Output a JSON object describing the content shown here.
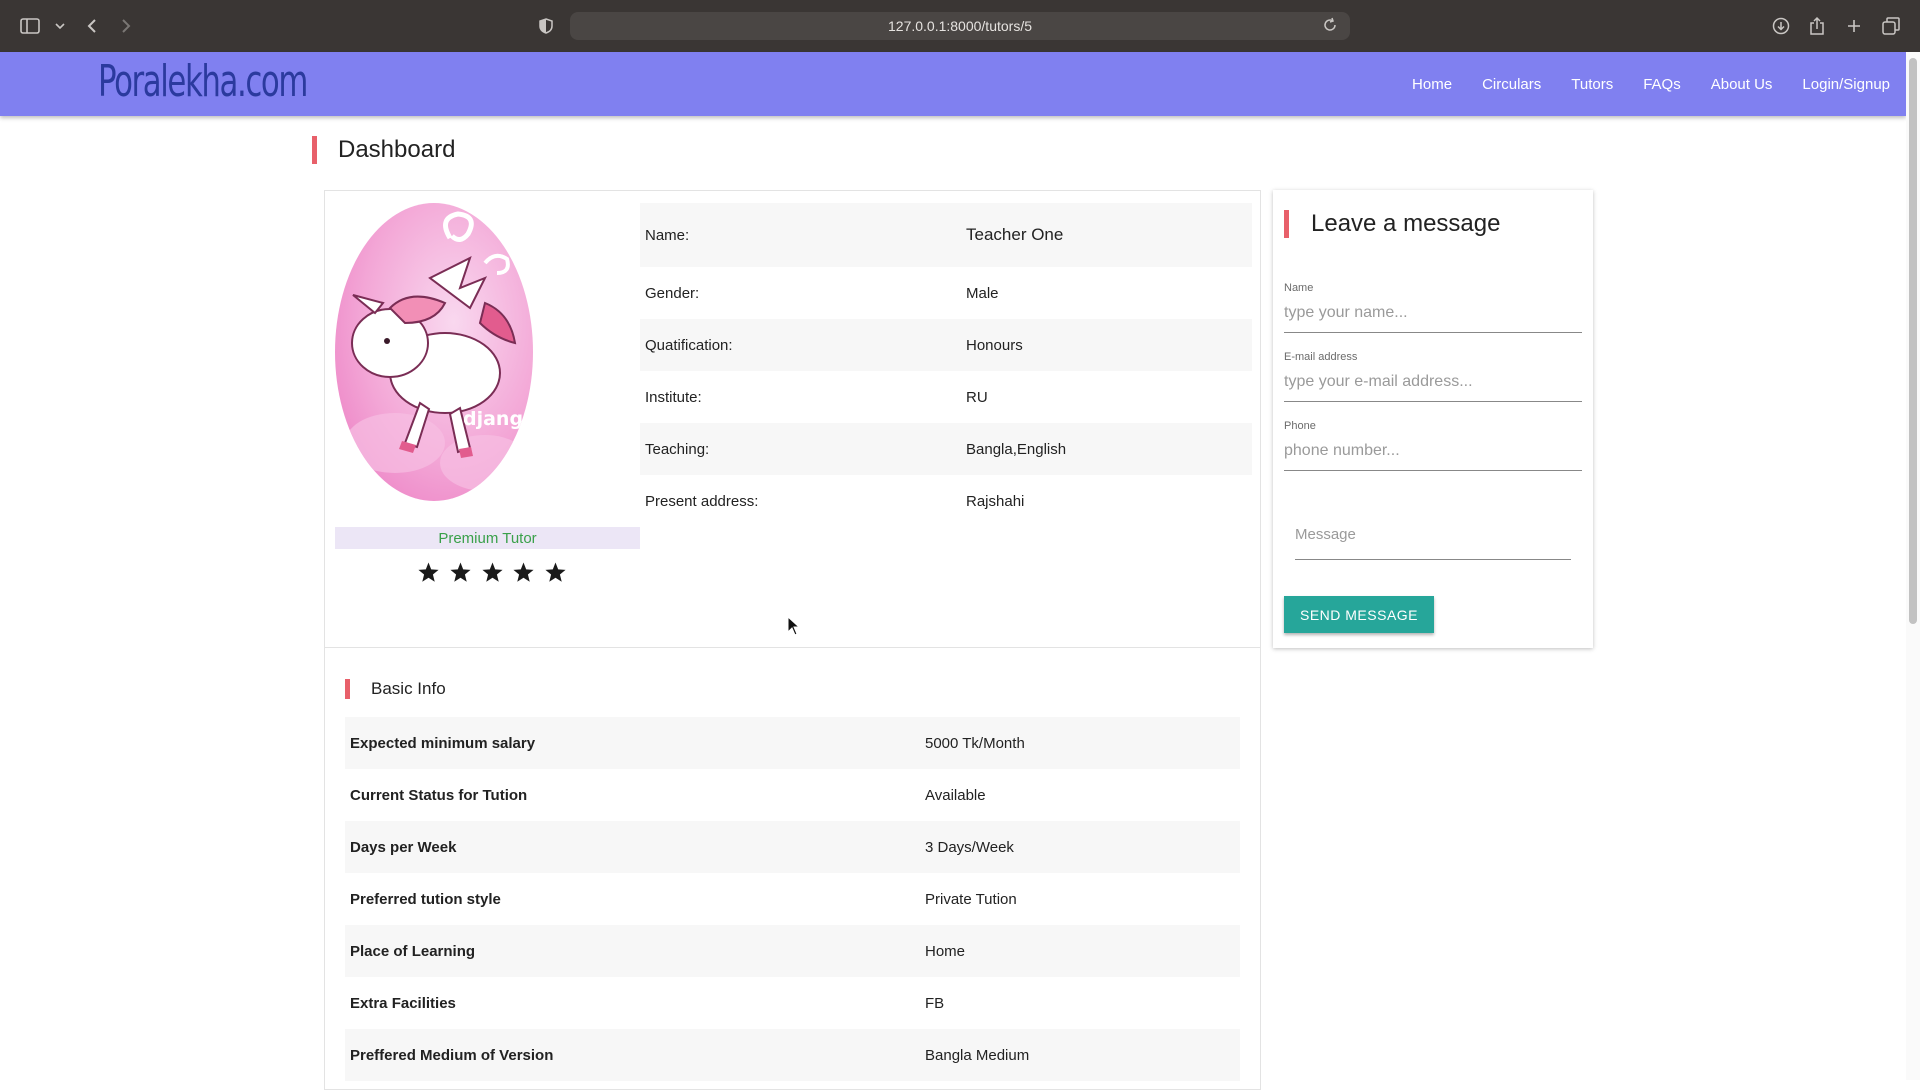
{
  "browser": {
    "url": "127.0.0.1:8000/tutors/5"
  },
  "navbar": {
    "logo": "Poralekha.com",
    "links": [
      "Home",
      "Circulars",
      "Tutors",
      "FAQs",
      "About Us",
      "Login/Signup"
    ]
  },
  "page": {
    "title": "Dashboard"
  },
  "profile": {
    "avatar_text": "django",
    "badge": "Premium Tutor",
    "rating_stars": 5,
    "details": [
      {
        "label": "Name:",
        "value": "Teacher One"
      },
      {
        "label": "Gender:",
        "value": "Male"
      },
      {
        "label": "Quatification:",
        "value": "Honours"
      },
      {
        "label": "Institute:",
        "value": "RU"
      },
      {
        "label": "Teaching:",
        "value": "Bangla,English"
      },
      {
        "label": "Present address:",
        "value": "Rajshahi"
      }
    ]
  },
  "basic_info": {
    "title": "Basic Info",
    "rows": [
      {
        "label": "Expected minimum salary",
        "value": "5000 Tk/Month"
      },
      {
        "label": "Current Status for Tution",
        "value": "Available"
      },
      {
        "label": "Days per Week",
        "value": "3 Days/Week"
      },
      {
        "label": "Preferred tution style",
        "value": "Private Tution"
      },
      {
        "label": "Place of Learning",
        "value": "Home"
      },
      {
        "label": "Extra Facilities",
        "value": "FB"
      },
      {
        "label": "Preffered Medium of Version",
        "value": "Bangla Medium"
      }
    ]
  },
  "message_form": {
    "title": "Leave a message",
    "name_label": "Name",
    "name_placeholder": "type your name...",
    "email_label": "E-mail address",
    "email_placeholder": "type your e-mail address...",
    "phone_label": "Phone",
    "phone_placeholder": "phone number...",
    "message_placeholder": "Message",
    "send_label": "SEND MESSAGE"
  },
  "colors": {
    "navbar": "#8080f0",
    "accent_bar": "#e8606a",
    "button": "#26a69a",
    "badge_text": "#3aa04a"
  }
}
